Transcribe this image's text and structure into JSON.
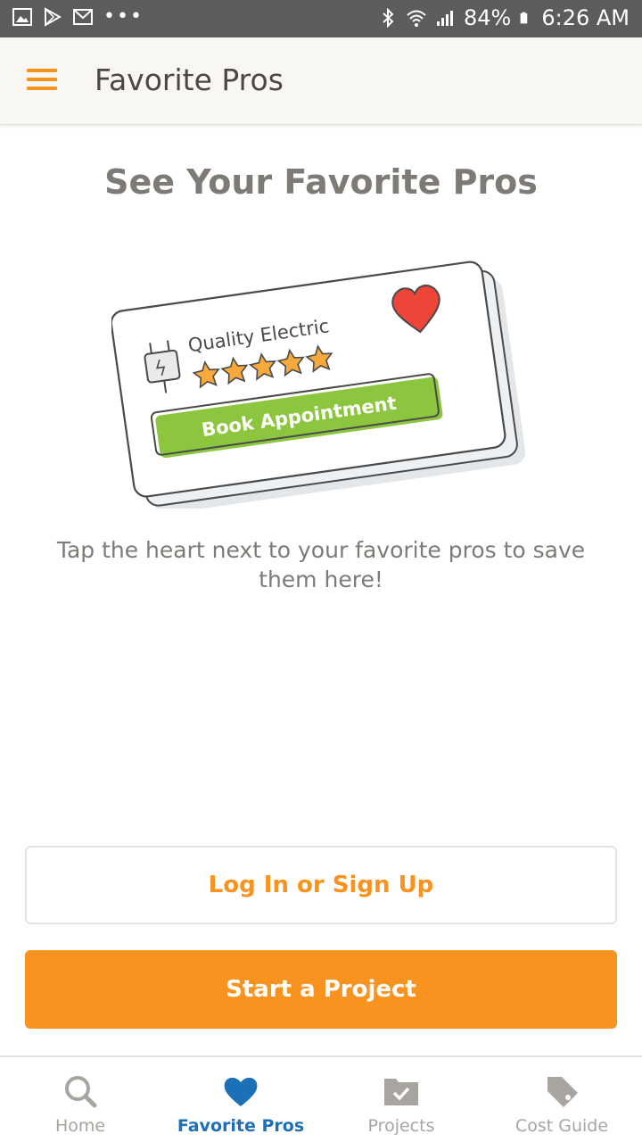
{
  "status_bar": {
    "battery": "84%",
    "time": "6:26 AM",
    "left_icons": [
      "image-icon",
      "play-store-icon",
      "gmail-icon",
      "more-dots-icon"
    ],
    "right_icons": [
      "bluetooth-icon",
      "wifi-icon",
      "signal-icon",
      "battery-icon"
    ]
  },
  "app_bar": {
    "title": "Favorite Pros",
    "menu_icon": "hamburger-menu-icon"
  },
  "content": {
    "headline": "See Your Favorite Pros",
    "illustration": {
      "business_name": "Quality Electric",
      "stars": 5,
      "button_label": "Book Appointment"
    },
    "message": "Tap the heart next to your favorite pros to save them here!"
  },
  "buttons": {
    "login_label": "Log In or Sign Up",
    "start_label": "Start a Project"
  },
  "bottom_nav": {
    "items": [
      {
        "label": "Home",
        "icon": "search-icon"
      },
      {
        "label": "Favorite Pros",
        "icon": "heart-icon",
        "active": true
      },
      {
        "label": "Projects",
        "icon": "folder-check-icon"
      },
      {
        "label": "Cost Guide",
        "icon": "price-tag-icon"
      }
    ]
  },
  "colors": {
    "accent_orange": "#f7931e",
    "active_blue": "#1c70b8",
    "status_bar": "#5c5c5c",
    "app_bar_bg": "#f8f7f3",
    "book_green": "#8cc63f"
  }
}
